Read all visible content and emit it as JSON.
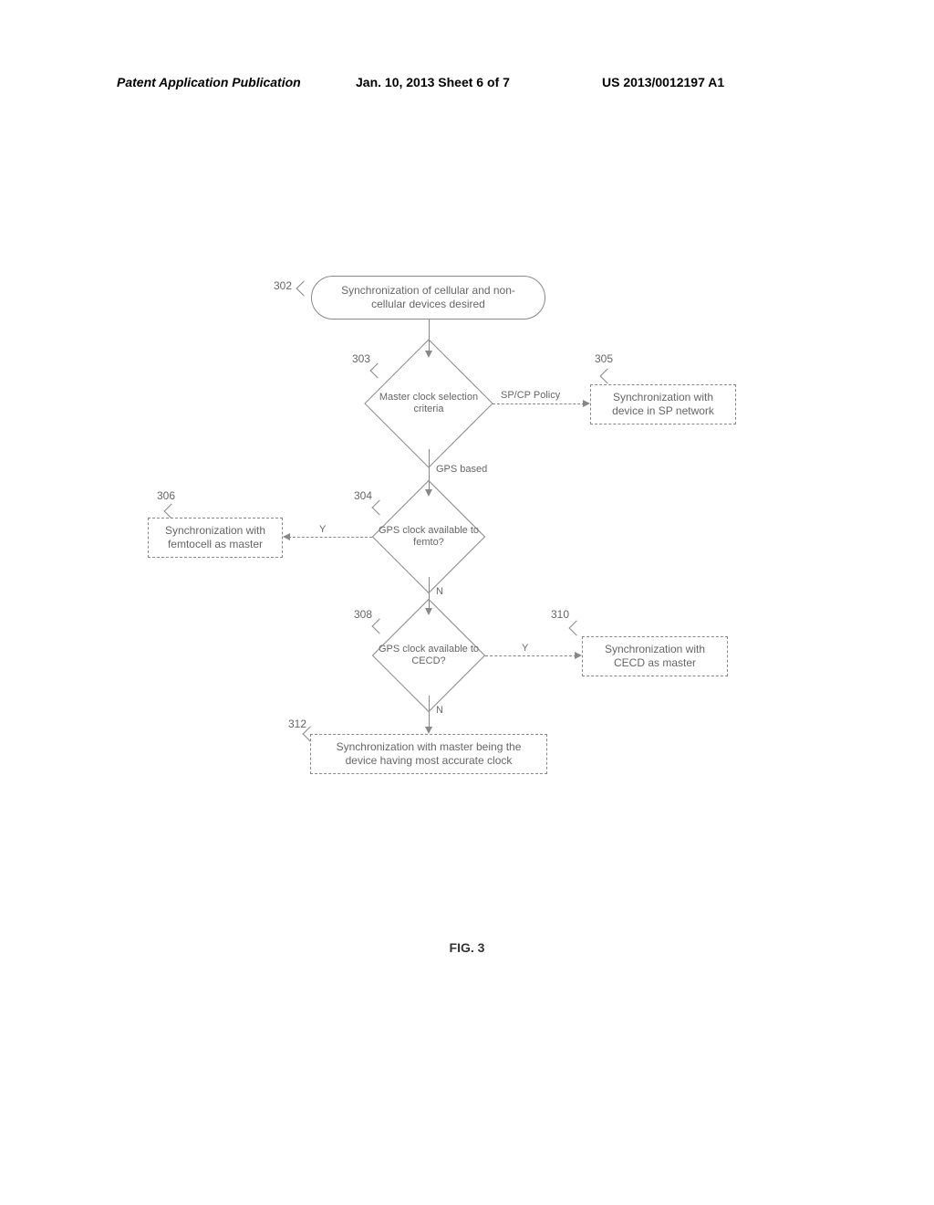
{
  "header": {
    "left": "Patent Application Publication",
    "center": "Jan. 10, 2013   Sheet 6 of 7",
    "right": "US 2013/0012197 A1"
  },
  "refs": {
    "r302": "302",
    "r303": "303",
    "r304": "304",
    "r305": "305",
    "r306": "306",
    "r308": "308",
    "r310": "310",
    "r312": "312"
  },
  "shapes": {
    "start": "Synchronization of cellular and non-\ncellular devices desired",
    "dec303": "Master clock\nselection criteria",
    "dec304": "GPS clock\navailable to\nfemto?",
    "dec308": "GPS clock\navailable to\nCECD?",
    "box305": "Synchronization with\ndevice in SP network",
    "box306": "Synchronization with\nfemtocell as master",
    "box310": "Synchronization with\nCECD as master",
    "box312": "Synchronization with master being the\ndevice having most accurate clock"
  },
  "edges": {
    "spcp": "SP/CP Policy",
    "gps": "GPS based",
    "y": "Y",
    "n": "N"
  },
  "figure": "FIG. 3"
}
